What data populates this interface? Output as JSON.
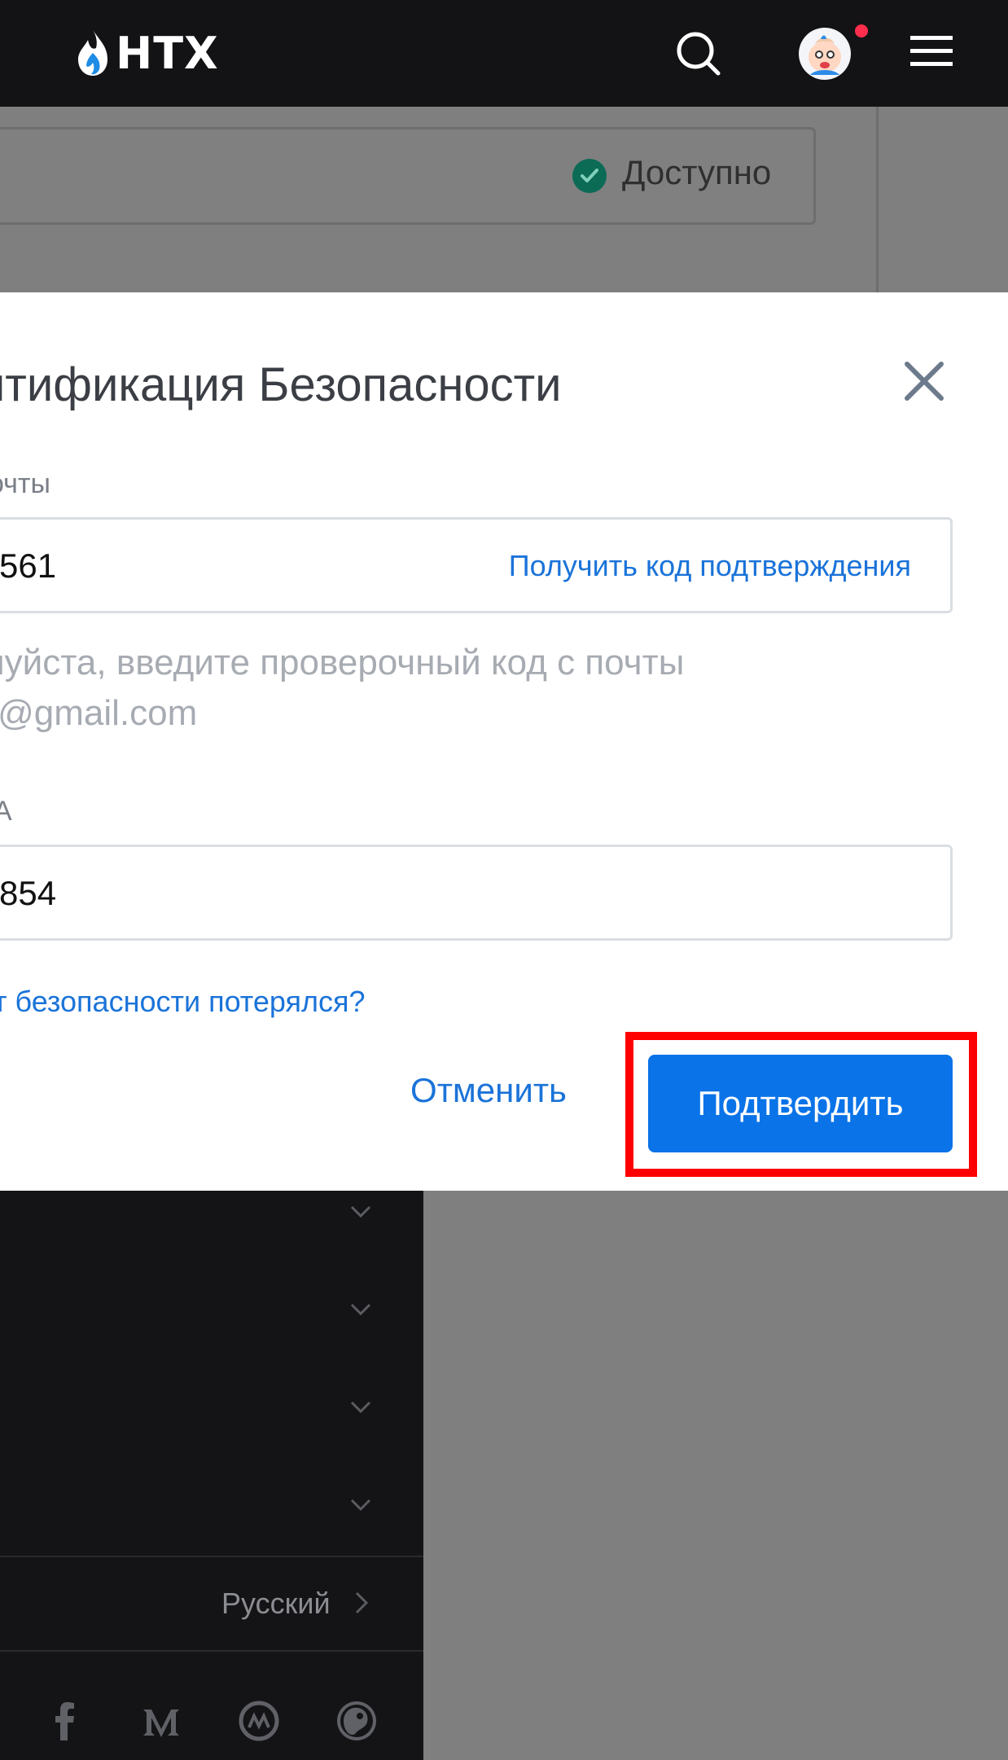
{
  "header": {
    "logo_text": "HTX",
    "icons": [
      "search-icon",
      "avatar",
      "menu-icon"
    ]
  },
  "background_page": {
    "status_text": "Доступно"
  },
  "modal": {
    "title": "ентификация Безопасности",
    "email_label": "очты",
    "email_code_value": "561",
    "get_code_label": "Получить код подтверждения",
    "hint_line1": "луйста, введите проверочный код с почты",
    "hint_line2": "*@gmail.com",
    "twofa_label": "А",
    "twofa_value": "854",
    "lost_link": "т безопасности потерялся?",
    "cancel_label": "Отменить",
    "confirm_label": "Подтвердить"
  },
  "footer": {
    "language": "Русский",
    "social_icons": [
      "facebook-icon",
      "medium-icon",
      "coinmarketcap-icon",
      "coingecko-icon"
    ]
  },
  "colors": {
    "accent": "#0a73e8",
    "link": "#1a73d9",
    "highlight": "#ff0000",
    "topbar": "#131315"
  }
}
